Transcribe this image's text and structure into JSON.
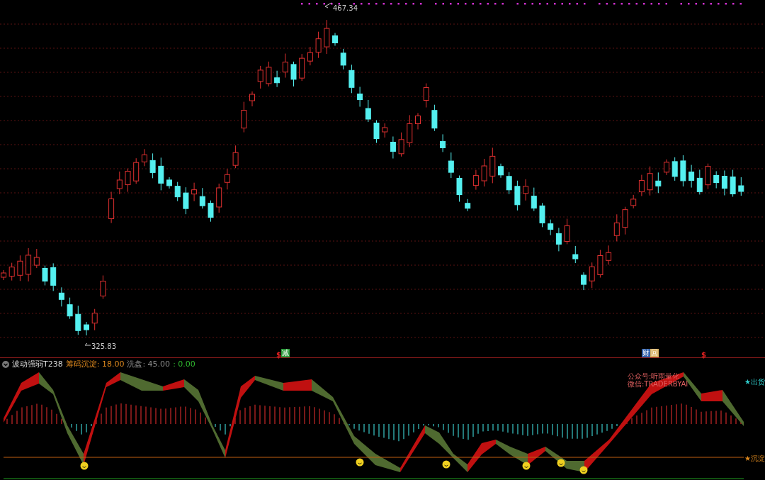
{
  "price_chart": {
    "high_label": "467.34",
    "low_label": "325.83"
  },
  "markers": [
    {
      "kind": "text",
      "text": "$",
      "color": "#e02020"
    },
    {
      "kind": "badge",
      "text": "减",
      "color": "#2a9a3a"
    },
    {
      "kind": "badge",
      "text": "财",
      "color": "#2f5fa8"
    },
    {
      "kind": "badge",
      "text": "回",
      "color": "#d8b060"
    },
    {
      "kind": "text",
      "text": "$",
      "color": "#e02020"
    }
  ],
  "indicator": {
    "name": "波动强弱T238",
    "params": [
      {
        "text": "筹码沉淀: 18.00",
        "color": "#e08a1e"
      },
      {
        "text": "洗盘: 45.00",
        "color": "#8a8a8a"
      },
      {
        "text": ": 0.00",
        "color": "#2fb82f"
      }
    ],
    "note_lines": [
      "公众号:听雨量化",
      "微信:TRADERBYAI"
    ],
    "levels": [
      {
        "label": "★出货",
        "color": "#30d0d0"
      },
      {
        "label": "★沉淀",
        "color": "#e08a1e"
      }
    ]
  }
}
